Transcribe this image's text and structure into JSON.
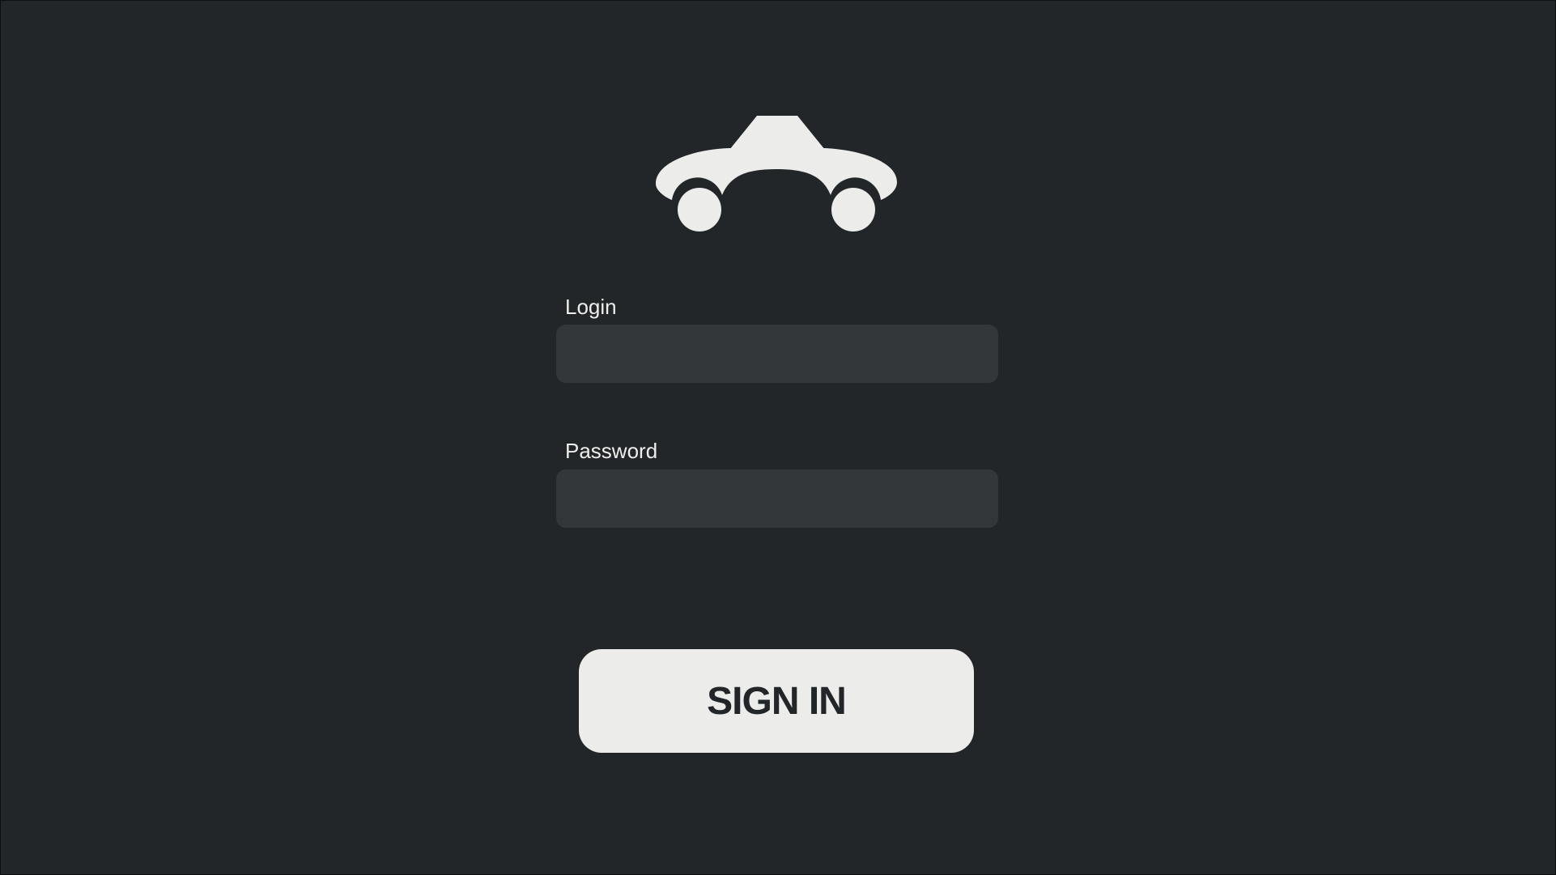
{
  "logo": {
    "icon": "car-icon",
    "color": "#ececea"
  },
  "login_form": {
    "login_label": "Login",
    "login_value": "",
    "password_label": "Password",
    "password_value": "",
    "signin_label": "SIGN IN"
  },
  "colors": {
    "background": "#222629",
    "field_background": "#33373a",
    "text": "#eeeeea",
    "button_background": "#ececea",
    "button_text": "#222629"
  }
}
